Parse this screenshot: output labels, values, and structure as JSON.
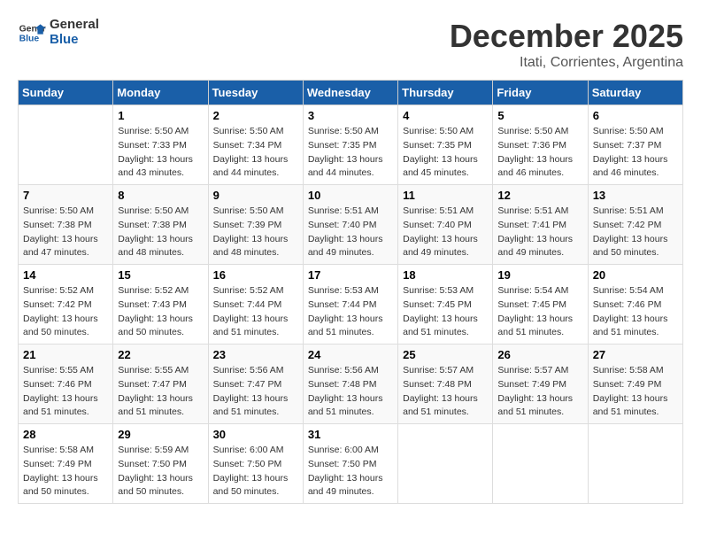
{
  "logo": {
    "line1": "General",
    "line2": "Blue"
  },
  "title": "December 2025",
  "subtitle": "Itati, Corrientes, Argentina",
  "days_header": [
    "Sunday",
    "Monday",
    "Tuesday",
    "Wednesday",
    "Thursday",
    "Friday",
    "Saturday"
  ],
  "weeks": [
    [
      {
        "num": "",
        "info": ""
      },
      {
        "num": "1",
        "info": "Sunrise: 5:50 AM\nSunset: 7:33 PM\nDaylight: 13 hours\nand 43 minutes."
      },
      {
        "num": "2",
        "info": "Sunrise: 5:50 AM\nSunset: 7:34 PM\nDaylight: 13 hours\nand 44 minutes."
      },
      {
        "num": "3",
        "info": "Sunrise: 5:50 AM\nSunset: 7:35 PM\nDaylight: 13 hours\nand 44 minutes."
      },
      {
        "num": "4",
        "info": "Sunrise: 5:50 AM\nSunset: 7:35 PM\nDaylight: 13 hours\nand 45 minutes."
      },
      {
        "num": "5",
        "info": "Sunrise: 5:50 AM\nSunset: 7:36 PM\nDaylight: 13 hours\nand 46 minutes."
      },
      {
        "num": "6",
        "info": "Sunrise: 5:50 AM\nSunset: 7:37 PM\nDaylight: 13 hours\nand 46 minutes."
      }
    ],
    [
      {
        "num": "7",
        "info": "Sunrise: 5:50 AM\nSunset: 7:38 PM\nDaylight: 13 hours\nand 47 minutes."
      },
      {
        "num": "8",
        "info": "Sunrise: 5:50 AM\nSunset: 7:38 PM\nDaylight: 13 hours\nand 48 minutes."
      },
      {
        "num": "9",
        "info": "Sunrise: 5:50 AM\nSunset: 7:39 PM\nDaylight: 13 hours\nand 48 minutes."
      },
      {
        "num": "10",
        "info": "Sunrise: 5:51 AM\nSunset: 7:40 PM\nDaylight: 13 hours\nand 49 minutes."
      },
      {
        "num": "11",
        "info": "Sunrise: 5:51 AM\nSunset: 7:40 PM\nDaylight: 13 hours\nand 49 minutes."
      },
      {
        "num": "12",
        "info": "Sunrise: 5:51 AM\nSunset: 7:41 PM\nDaylight: 13 hours\nand 49 minutes."
      },
      {
        "num": "13",
        "info": "Sunrise: 5:51 AM\nSunset: 7:42 PM\nDaylight: 13 hours\nand 50 minutes."
      }
    ],
    [
      {
        "num": "14",
        "info": "Sunrise: 5:52 AM\nSunset: 7:42 PM\nDaylight: 13 hours\nand 50 minutes."
      },
      {
        "num": "15",
        "info": "Sunrise: 5:52 AM\nSunset: 7:43 PM\nDaylight: 13 hours\nand 50 minutes."
      },
      {
        "num": "16",
        "info": "Sunrise: 5:52 AM\nSunset: 7:44 PM\nDaylight: 13 hours\nand 51 minutes."
      },
      {
        "num": "17",
        "info": "Sunrise: 5:53 AM\nSunset: 7:44 PM\nDaylight: 13 hours\nand 51 minutes."
      },
      {
        "num": "18",
        "info": "Sunrise: 5:53 AM\nSunset: 7:45 PM\nDaylight: 13 hours\nand 51 minutes."
      },
      {
        "num": "19",
        "info": "Sunrise: 5:54 AM\nSunset: 7:45 PM\nDaylight: 13 hours\nand 51 minutes."
      },
      {
        "num": "20",
        "info": "Sunrise: 5:54 AM\nSunset: 7:46 PM\nDaylight: 13 hours\nand 51 minutes."
      }
    ],
    [
      {
        "num": "21",
        "info": "Sunrise: 5:55 AM\nSunset: 7:46 PM\nDaylight: 13 hours\nand 51 minutes."
      },
      {
        "num": "22",
        "info": "Sunrise: 5:55 AM\nSunset: 7:47 PM\nDaylight: 13 hours\nand 51 minutes."
      },
      {
        "num": "23",
        "info": "Sunrise: 5:56 AM\nSunset: 7:47 PM\nDaylight: 13 hours\nand 51 minutes."
      },
      {
        "num": "24",
        "info": "Sunrise: 5:56 AM\nSunset: 7:48 PM\nDaylight: 13 hours\nand 51 minutes."
      },
      {
        "num": "25",
        "info": "Sunrise: 5:57 AM\nSunset: 7:48 PM\nDaylight: 13 hours\nand 51 minutes."
      },
      {
        "num": "26",
        "info": "Sunrise: 5:57 AM\nSunset: 7:49 PM\nDaylight: 13 hours\nand 51 minutes."
      },
      {
        "num": "27",
        "info": "Sunrise: 5:58 AM\nSunset: 7:49 PM\nDaylight: 13 hours\nand 51 minutes."
      }
    ],
    [
      {
        "num": "28",
        "info": "Sunrise: 5:58 AM\nSunset: 7:49 PM\nDaylight: 13 hours\nand 50 minutes."
      },
      {
        "num": "29",
        "info": "Sunrise: 5:59 AM\nSunset: 7:50 PM\nDaylight: 13 hours\nand 50 minutes."
      },
      {
        "num": "30",
        "info": "Sunrise: 6:00 AM\nSunset: 7:50 PM\nDaylight: 13 hours\nand 50 minutes."
      },
      {
        "num": "31",
        "info": "Sunrise: 6:00 AM\nSunset: 7:50 PM\nDaylight: 13 hours\nand 49 minutes."
      },
      {
        "num": "",
        "info": ""
      },
      {
        "num": "",
        "info": ""
      },
      {
        "num": "",
        "info": ""
      }
    ]
  ]
}
